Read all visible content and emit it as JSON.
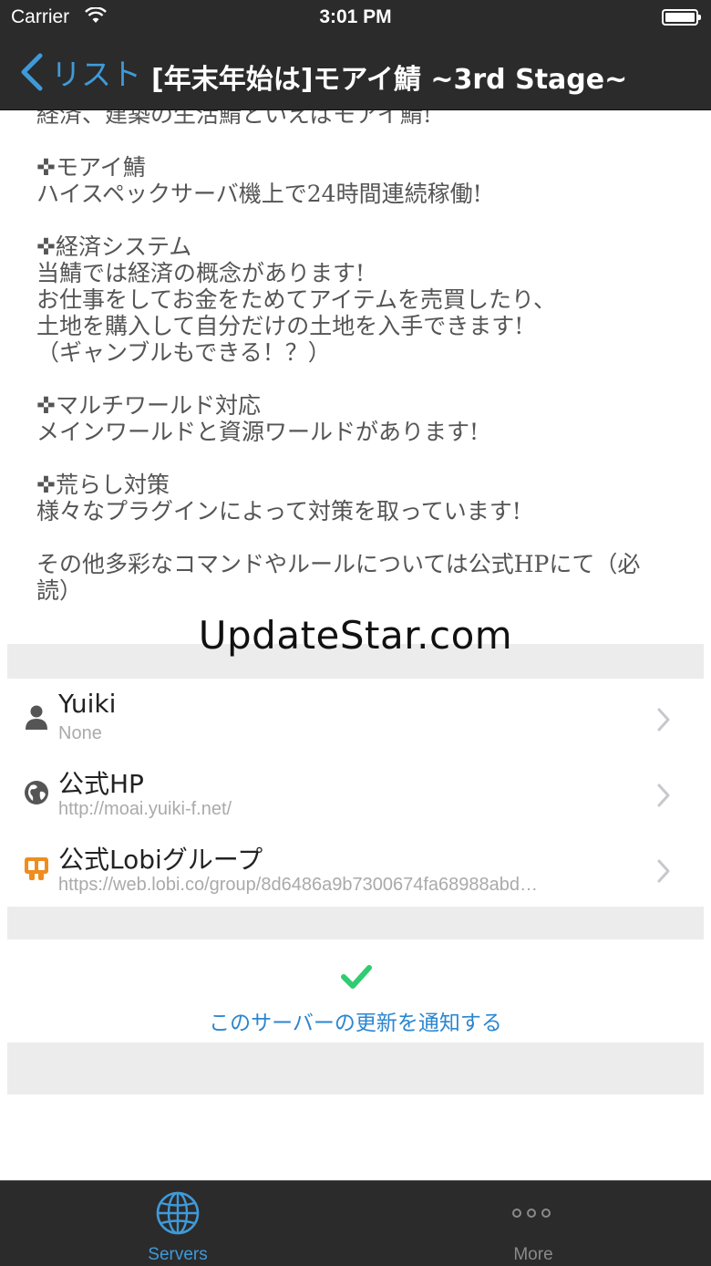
{
  "status_bar": {
    "carrier": "Carrier",
    "time": "3:01 PM"
  },
  "nav": {
    "back_label": "リスト",
    "title": "[年末年始は]モアイ鯖 ~3rd Stage~"
  },
  "description": "経済、建築の生活鯖といえばモアイ鯖!\n\n✜モアイ鯖\nハイスペックサーバ機上で24時間連続稼働!\n\n✜経済システム\n当鯖では経済の概念があります!\nお仕事をしてお金をためてアイテムを売買したり、\n土地を購入して自分だけの土地を入手できます!\n（ギャンブルもできる！？）\n\n✜マルチワールド対応\nメインワールドと資源ワールドがあります!\n\n✜荒らし対策\n様々なプラグインによって対策を取っています!\n\nその他多彩なコマンドやルールについては公式HPにて（必\n読）",
  "watermark": "UpdateStar.com",
  "links": [
    {
      "icon": "person-icon",
      "title": "Yuiki",
      "subtitle": "None"
    },
    {
      "icon": "globe-icon",
      "title": "公式HP",
      "subtitle": "http://moai.yuiki-f.net/"
    },
    {
      "icon": "lobi-icon",
      "title": "公式Lobiグループ",
      "subtitle": "https://web.lobi.co/group/8d6486a9b7300674fa68988abd…"
    }
  ],
  "notify": {
    "label": "このサーバーの更新を通知する",
    "icon": "check-icon",
    "check_color": "#2fcc71"
  },
  "tabs": [
    {
      "icon": "globe-icon",
      "label": "Servers",
      "active": true
    },
    {
      "icon": "more-icon",
      "label": "More",
      "active": false
    }
  ],
  "colors": {
    "accent": "#3f9ad8",
    "bar_bg": "#2b2b2b",
    "link_blue": "#2b86d0",
    "lobi_orange": "#f08c1e"
  }
}
